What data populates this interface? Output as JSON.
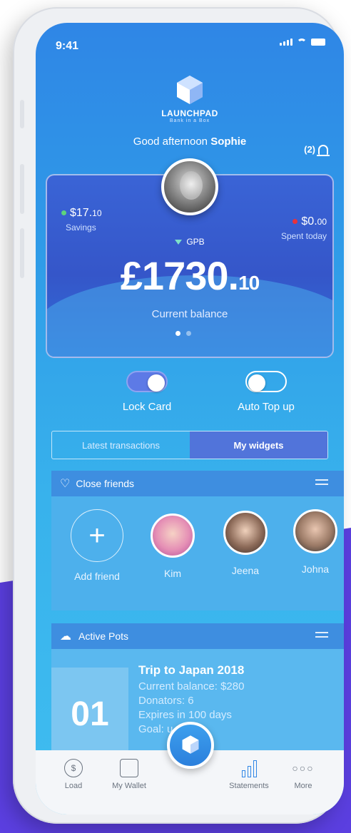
{
  "status": {
    "time": "9:41"
  },
  "brand": {
    "name": "LAUNCHPAD",
    "tagline": "Bank in a Box"
  },
  "header": {
    "greeting": "Good afternoon",
    "user_name": "Sophie",
    "notification_count": "(2)"
  },
  "card": {
    "savings_value": "$17.",
    "savings_cents": "10",
    "savings_label": "Savings",
    "spent_value": "$0.",
    "spent_cents": "00",
    "spent_label": "Spent today",
    "currency": "GPB",
    "balance_main": "£1730.",
    "balance_cents": "10",
    "balance_label": "Current balance",
    "pager_total": 2,
    "pager_active": 1
  },
  "toggles": {
    "lock_card_label": "Lock Card",
    "lock_card_on": true,
    "auto_topup_label": "Auto Top up",
    "auto_topup_on": false
  },
  "tabs": [
    {
      "label": "Latest transactions",
      "active": false
    },
    {
      "label": "My widgets",
      "active": true
    }
  ],
  "close_friends": {
    "title": "Close friends",
    "add_label": "Add friend",
    "friends": [
      {
        "name": "Kim"
      },
      {
        "name": "Jeena"
      },
      {
        "name": "Johna"
      }
    ]
  },
  "active_pots": {
    "title": "Active Pots",
    "pot": {
      "number": "01",
      "title": "Trip to Japan 2018",
      "balance": "Current balance: $280",
      "donators": "Donators: 6",
      "expires": "Expires in 100 days",
      "goal": "Goal: u"
    }
  },
  "nav": {
    "load": "Load",
    "wallet": "My Wallet",
    "statements": "Statements",
    "more": "More"
  },
  "colors": {
    "accent": "#2f86e6",
    "savings_dot": "#5ed37c",
    "spent_dot": "#e8323c",
    "purple_bg": "#5b3fe0"
  }
}
